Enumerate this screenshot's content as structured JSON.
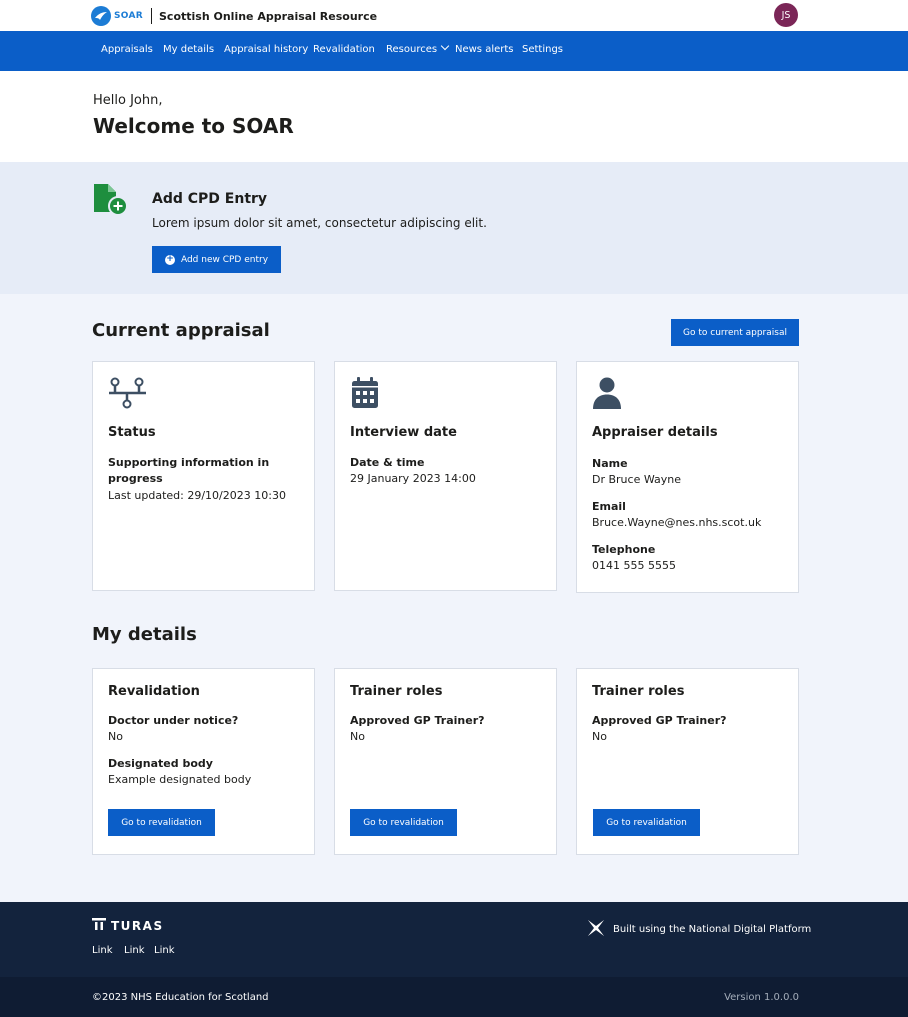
{
  "header": {
    "brand_short": "SOAR",
    "brand_name": "Scottish Online Appraisal Resource",
    "avatar_initials": "JS"
  },
  "nav": {
    "items": [
      {
        "label": "Appraisals"
      },
      {
        "label": "My details"
      },
      {
        "label": "Appraisal history"
      },
      {
        "label": "Revalidation"
      },
      {
        "label": "Resources",
        "has_dropdown": true
      },
      {
        "label": "News alerts"
      },
      {
        "label": "Settings"
      }
    ]
  },
  "hero": {
    "greeting": "Hello John,",
    "title": "Welcome to SOAR"
  },
  "cpd": {
    "icon": "file-plus-icon",
    "title": "Add CPD Entry",
    "description": "Lorem ipsum dolor sit amet, consectetur adipiscing elit.",
    "button_label": "Add new CPD entry"
  },
  "current_appraisal": {
    "title": "Current appraisal",
    "button_label": "Go to current appraisal",
    "cards": {
      "status": {
        "icon": "workflow-icon",
        "title": "Status",
        "label_line1": "Supporting information in",
        "label_line2": "progress",
        "last_updated": "Last updated: 29/10/2023 10:30"
      },
      "interview": {
        "icon": "calendar-icon",
        "title": "Interview date",
        "label": "Date & time",
        "value": "29 January 2023 14:00"
      },
      "appraiser": {
        "icon": "user-icon",
        "title": "Appraiser details",
        "name_label": "Name",
        "name_value": "Dr Bruce Wayne",
        "email_label": "Email",
        "email_value": "Bruce.Wayne@nes.nhs.scot.uk",
        "phone_label": "Telephone",
        "phone_value": "0141 555 5555"
      }
    }
  },
  "my_details": {
    "title": "My details",
    "cards": {
      "revalidation": {
        "title": "Revalidation",
        "label1": "Doctor under notice?",
        "value1": "No",
        "label2": "Designated body",
        "value2": "Example designated body",
        "button_label": "Go to revalidation"
      },
      "trainer1": {
        "title": "Trainer roles",
        "label1": "Approved GP Trainer?",
        "value1": "No",
        "button_label": "Go to revalidation"
      },
      "trainer2": {
        "title": "Trainer roles",
        "label1": "Approved GP Trainer?",
        "value1": "No",
        "button_label": "Go to revalidation"
      }
    }
  },
  "footer": {
    "turas_label": "TURAS",
    "links": [
      "Link",
      "Link",
      "Link"
    ],
    "platform_text": "Built using the National Digital Platform",
    "copyright": "©2023 NHS Education for Scotland",
    "version": "Version 1.0.0.0"
  },
  "colors": {
    "primary": "#0b5ec8",
    "page_background": "#f1f4fb",
    "band_background": "#e6ecf7",
    "footer": "#13233d",
    "cpd_icon_green": "#1e8e3e",
    "icon_slate": "#3d4f63",
    "avatar": "#7b2657"
  }
}
